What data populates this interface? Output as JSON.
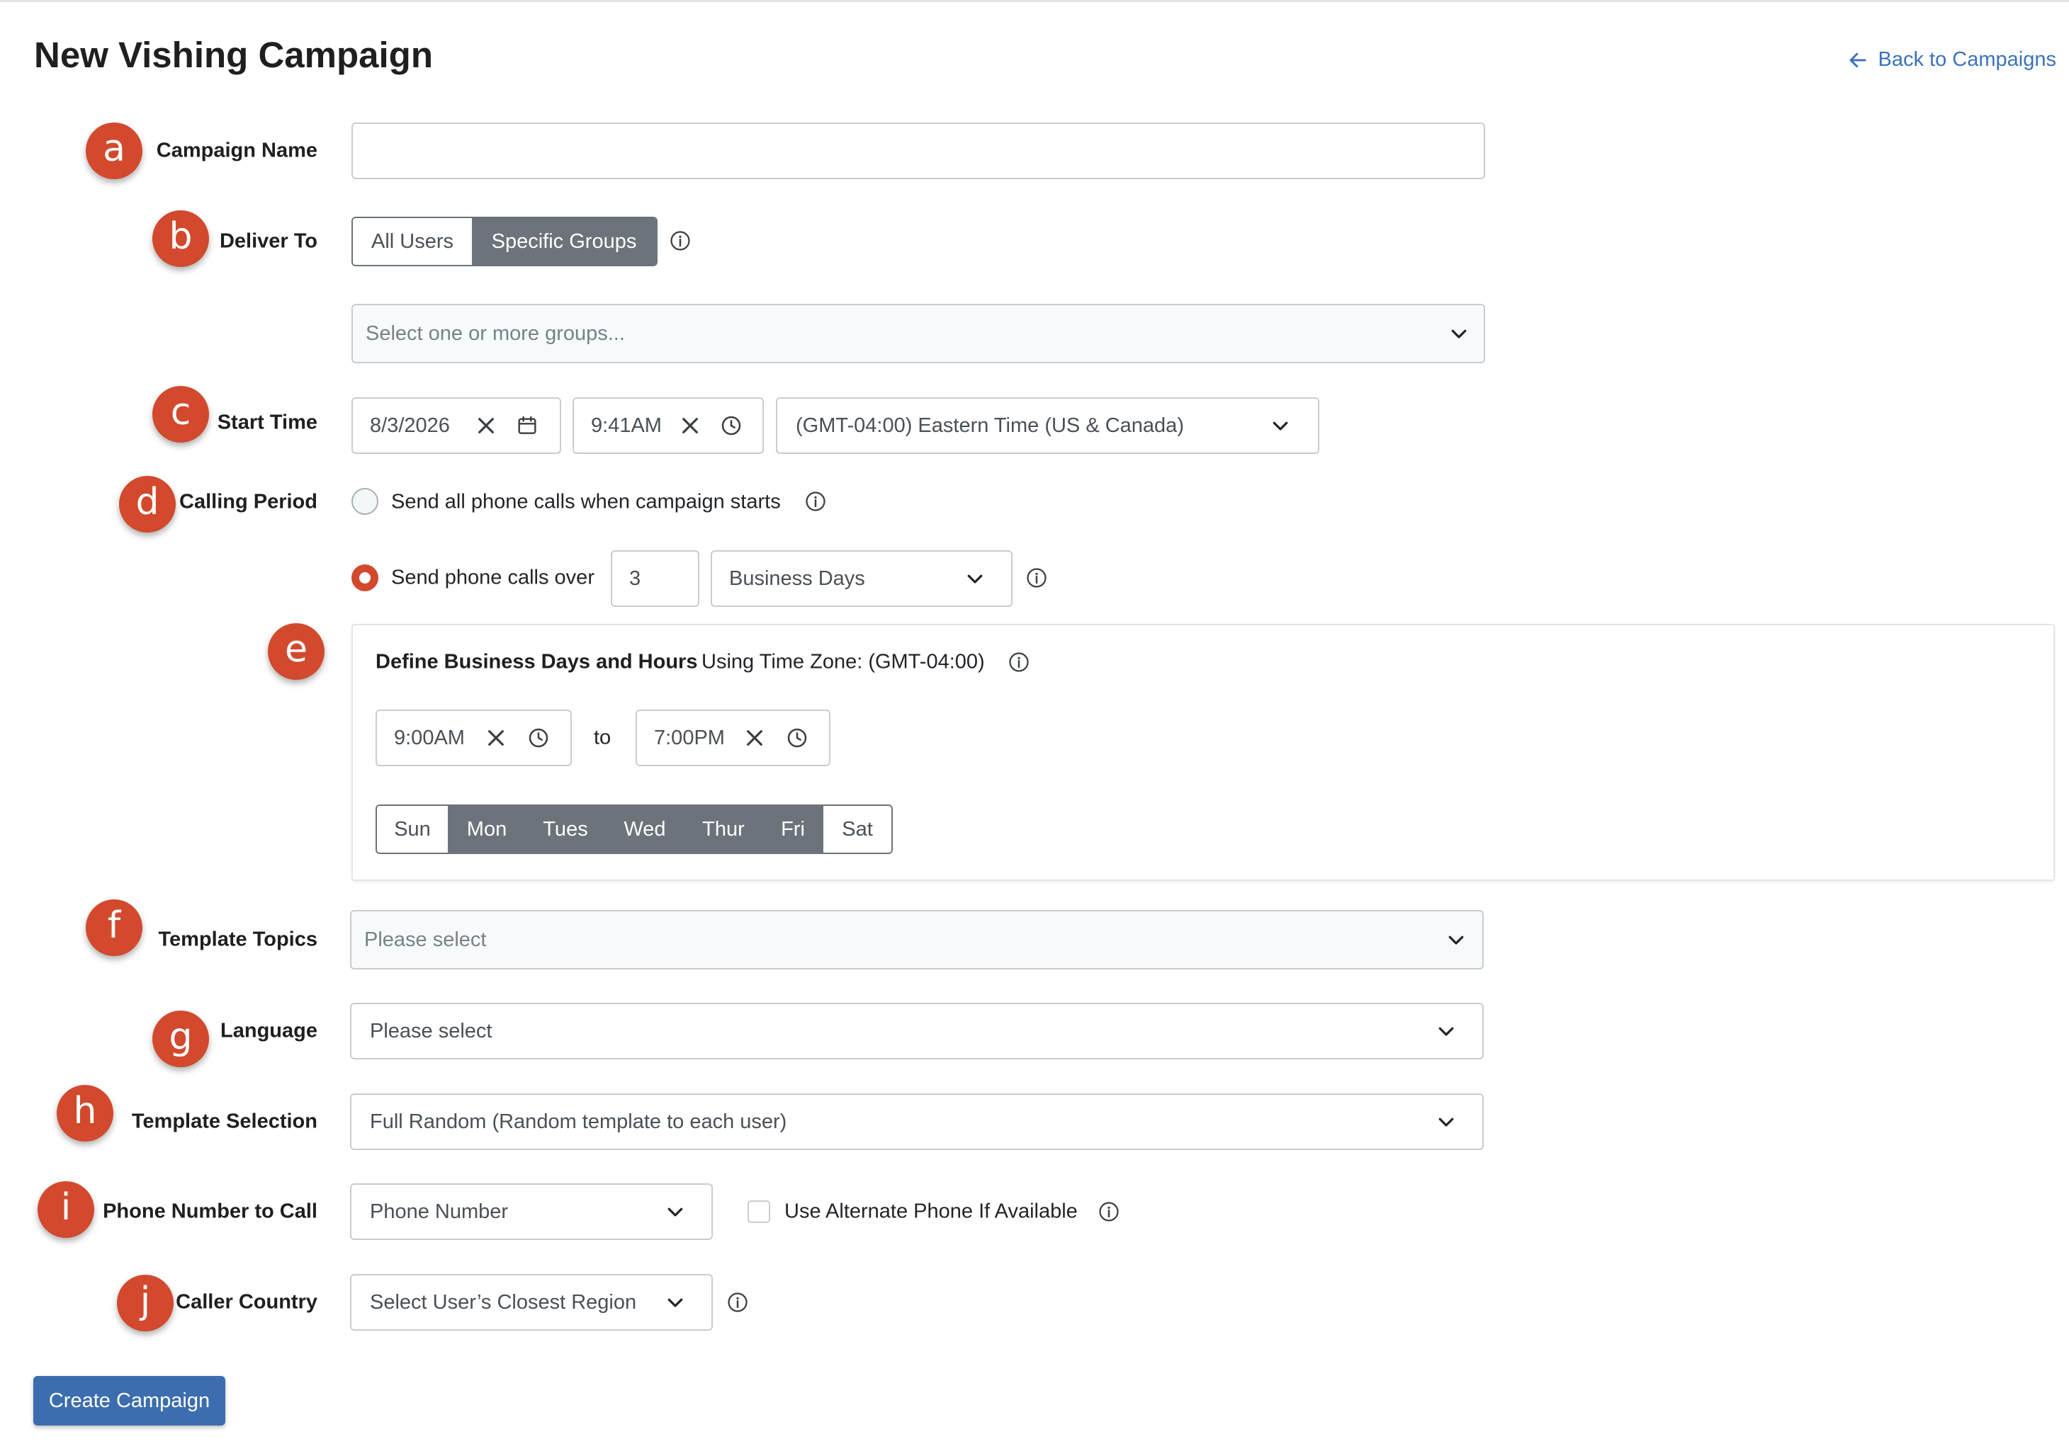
{
  "header": {
    "title": "New Vishing Campaign",
    "back_link": "Back to Campaigns"
  },
  "badges": [
    "a",
    "b",
    "c",
    "d",
    "e",
    "f",
    "g",
    "h",
    "i",
    "j"
  ],
  "campaign_name": {
    "label": "Campaign Name",
    "value": ""
  },
  "deliver_to": {
    "label": "Deliver To",
    "options": [
      "All Users",
      "Specific Groups"
    ],
    "selected": "Specific Groups",
    "groups_placeholder": "Select one or more groups..."
  },
  "start_time": {
    "label": "Start Time",
    "date": "8/3/2026",
    "time": "9:41AM",
    "timezone": "(GMT-04:00) Eastern Time (US & Canada)"
  },
  "calling_period": {
    "label": "Calling Period",
    "option_all": "Send all phone calls when campaign starts",
    "option_over": "Send phone calls over",
    "over_value": "3",
    "over_unit": "Business Days",
    "selected": "option_over"
  },
  "business_days": {
    "heading": "Define Business Days and Hours",
    "timezone_note": "Using Time Zone: (GMT-04:00)",
    "from_time": "9:00AM",
    "to_label": "to",
    "to_time": "7:00PM",
    "days": [
      "Sun",
      "Mon",
      "Tues",
      "Wed",
      "Thur",
      "Fri",
      "Sat"
    ],
    "selected_days": [
      "Mon",
      "Tues",
      "Wed",
      "Thur",
      "Fri"
    ]
  },
  "template_topics": {
    "label": "Template Topics",
    "placeholder": "Please select"
  },
  "language": {
    "label": "Language",
    "placeholder": "Please select"
  },
  "template_selection": {
    "label": "Template Selection",
    "value": "Full Random (Random template to each user)"
  },
  "phone_number": {
    "label": "Phone Number to Call",
    "value": "Phone Number",
    "alt_label": "Use Alternate Phone If Available",
    "alt_checked": false
  },
  "caller_country": {
    "label": "Caller Country",
    "value": "Select User’s Closest Region"
  },
  "submit": {
    "label": "Create Campaign"
  },
  "colors": {
    "accent": "#d2492d",
    "primary_button": "#3c6dae",
    "segment_active": "#6c737a",
    "link": "#3b73b9"
  }
}
